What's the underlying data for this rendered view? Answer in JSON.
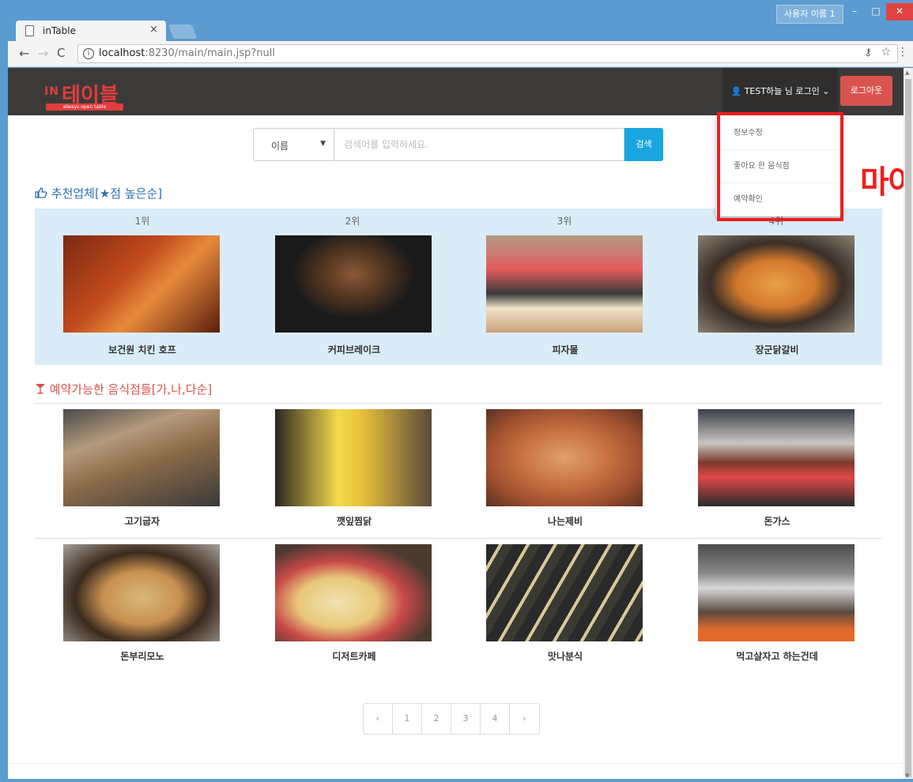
{
  "window": {
    "user_badge": "사용자 이름 1",
    "min_glyph": "–",
    "max_glyph": "□",
    "close_glyph": "✕"
  },
  "tab": {
    "title": "inTable",
    "close": "×"
  },
  "address": {
    "host": "localhost",
    "path": ":8230/main/main.jsp?null"
  },
  "nav": {
    "back": "←",
    "forward": "→",
    "reload": "C",
    "menu": "⋮",
    "info": "i",
    "key": "⚷",
    "star": "☆"
  },
  "header": {
    "logo_in": "IN",
    "logo_text": "테이블",
    "logo_tagline": "always open table",
    "user_label": "TEST하늘 님 로그인",
    "user_icon": "👤",
    "chevron": "⌄",
    "logout_label": "로그아웃"
  },
  "dropdown": {
    "items": [
      "정보수정",
      "좋아요 한 음식점",
      "예약확인"
    ]
  },
  "overflow_text": "마이",
  "search": {
    "select_value": "이름",
    "caret": "▼",
    "placeholder": "검색어를 입력하세요.",
    "button_label": "검색"
  },
  "recommended": {
    "title": "추천업체[★점 높은순]",
    "icon": "thumbs-up-icon",
    "ranks": [
      "1위",
      "2위",
      "3위",
      "4위"
    ],
    "items": [
      "보건원 치킨 호프",
      "커피브레이크",
      "피자몰",
      "장군닭갈비"
    ]
  },
  "reservable": {
    "title": "예약가능한 음식점들[가,나,다순]",
    "icon": "cocktail-icon",
    "row1": [
      "고기굽자",
      "깻잎찜닭",
      "나는제비",
      "돈가스"
    ],
    "row2": [
      "돈부리모노",
      "디저트카페",
      "맛나분식",
      "먹고살자고 하는건데"
    ]
  },
  "pagination": {
    "prev": "‹",
    "pages": [
      "1",
      "2",
      "3",
      "4"
    ],
    "next": "›"
  },
  "colors": {
    "navbar": "#3b3a39",
    "accent_red": "#d9534f",
    "search_blue": "#1aa6e0",
    "rec_panel": "#d9ecf7",
    "highlight": "#f01d1d"
  }
}
